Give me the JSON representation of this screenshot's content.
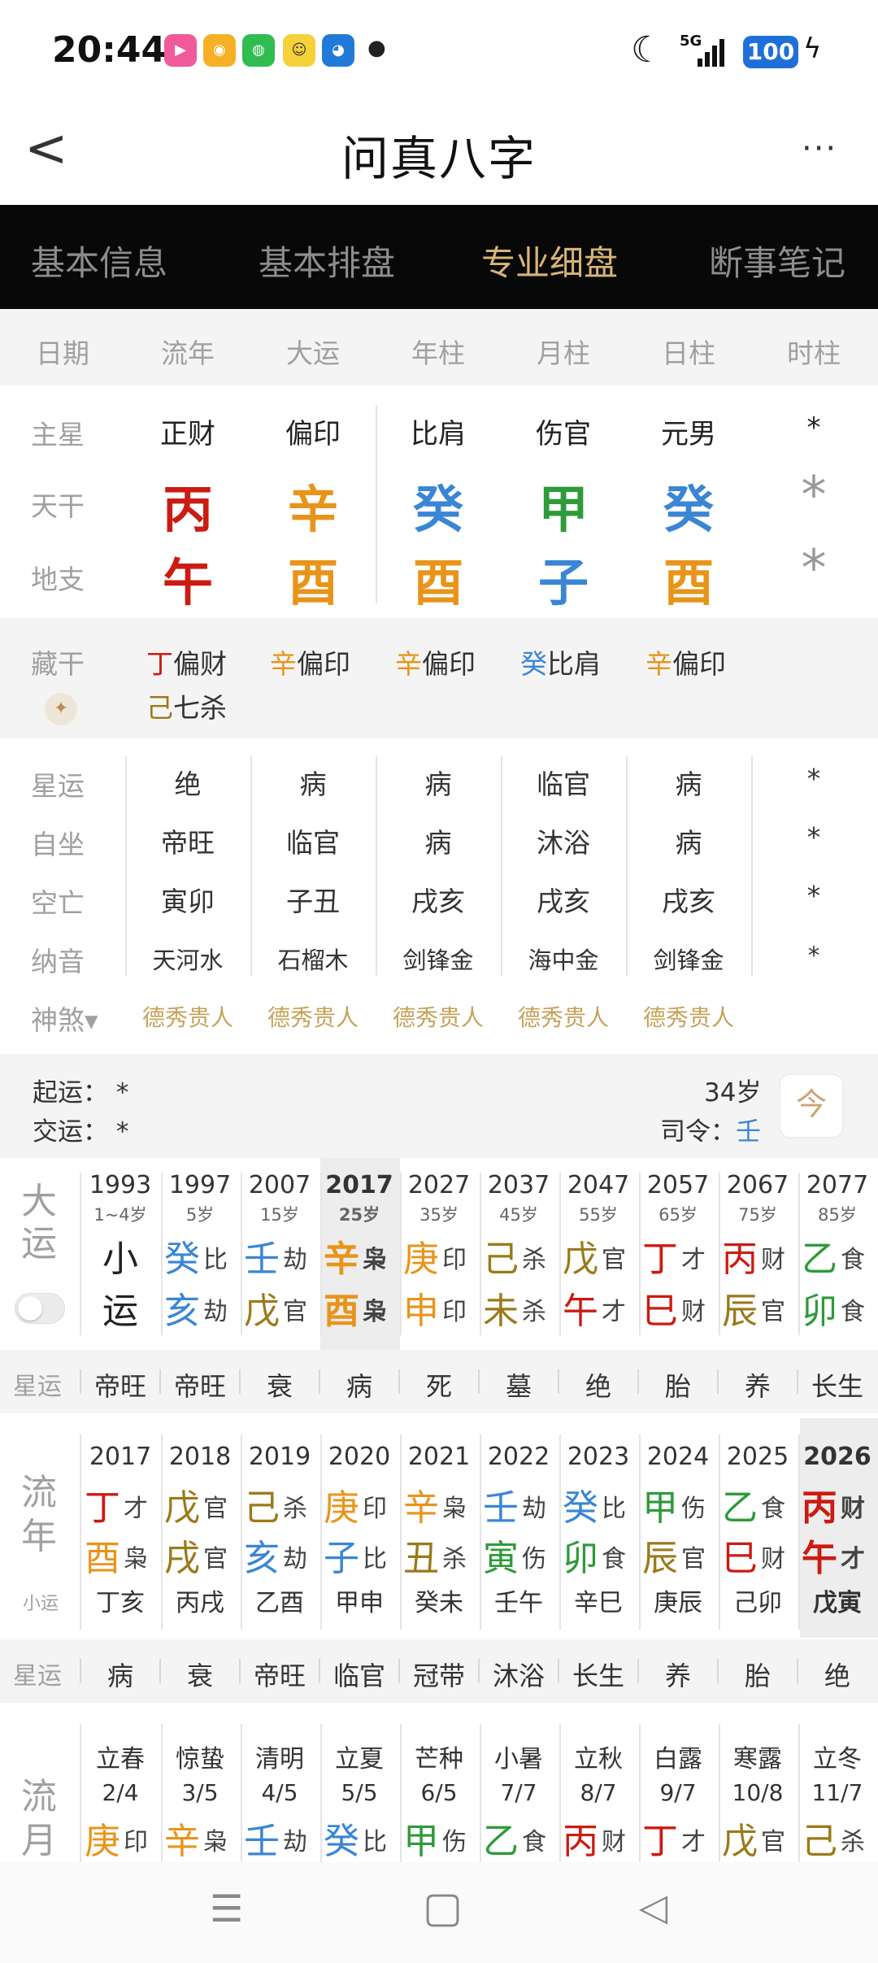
{
  "status": {
    "time": "20:44",
    "battery": "100",
    "signal": "5G",
    "dot": "●"
  },
  "header": {
    "back": "<",
    "title": "问真八字",
    "more": "···"
  },
  "tabs": [
    {
      "label": "基本信息"
    },
    {
      "label": "基本排盘"
    },
    {
      "label": "专业细盘"
    },
    {
      "label": "断事笔记"
    }
  ],
  "columns": [
    "日期",
    "流年",
    "大运",
    "年柱",
    "月柱",
    "日柱",
    "时柱"
  ],
  "pan": {
    "zhuxing_label": "主星",
    "zhuxing": [
      "正财",
      "偏印",
      "比肩",
      "伤官",
      "元男",
      "*"
    ],
    "tiangan_label": "天干",
    "tiangan": [
      "丙",
      "辛",
      "癸",
      "甲",
      "癸",
      "*"
    ],
    "dizhi_label": "地支",
    "dizhi": [
      "午",
      "酉",
      "酉",
      "子",
      "酉",
      "*"
    ]
  },
  "canggan": {
    "label": "藏干",
    "c1a_g": "丁",
    "c1a_t": "偏财",
    "c1b_g": "己",
    "c1b_t": "七杀",
    "c2_g": "辛",
    "c2_t": "偏印",
    "c3_g": "辛",
    "c3_t": "偏印",
    "c4_g": "癸",
    "c4_t": "比肩",
    "c5_g": "辛",
    "c5_t": "偏印"
  },
  "detail": {
    "xingyun_label": "星运",
    "xingyun": [
      "绝",
      "病",
      "病",
      "临官",
      "病",
      "*"
    ],
    "zizuo_label": "自坐",
    "zizuo": [
      "帝旺",
      "临官",
      "病",
      "沐浴",
      "病",
      "*"
    ],
    "kongwang_label": "空亡",
    "kongwang": [
      "寅卯",
      "子丑",
      "戌亥",
      "戌亥",
      "戌亥",
      "*"
    ],
    "nayin_label": "纳音",
    "nayin": [
      "天河水",
      "石榴木",
      "剑锋金",
      "海中金",
      "剑锋金",
      "*"
    ],
    "shensha_label": "神煞▾",
    "shensha": [
      "德秀贵人",
      "德秀贵人",
      "德秀贵人",
      "德秀贵人",
      "德秀贵人"
    ]
  },
  "qiyun": {
    "qiyun_label": "起运：",
    "qiyun_val": "*",
    "jiaoyun_label": "交运：",
    "jiaoyun_val": "*",
    "age": "34岁",
    "siling_label": "司令：",
    "siling_val": "壬",
    "cal_icon": "今"
  },
  "dayun": {
    "side1": "大",
    "side2": "运",
    "years": [
      "1993",
      "1997",
      "2007",
      "2017",
      "2027",
      "2037",
      "2047",
      "2057",
      "2067",
      "2077"
    ],
    "ages": [
      "1~4岁",
      "5岁",
      "15岁",
      "25岁",
      "35岁",
      "45岁",
      "55岁",
      "65岁",
      "75岁",
      "85岁"
    ],
    "top": [
      [
        "小",
        ""
      ],
      [
        "癸",
        "比"
      ],
      [
        "壬",
        "劫"
      ],
      [
        "辛",
        "枭"
      ],
      [
        "庚",
        "印"
      ],
      [
        "己",
        "杀"
      ],
      [
        "戊",
        "官"
      ],
      [
        "丁",
        "才"
      ],
      [
        "丙",
        "财"
      ],
      [
        "乙",
        "食"
      ]
    ],
    "bot": [
      [
        "运",
        ""
      ],
      [
        "亥",
        "劫"
      ],
      [
        "戊",
        "官"
      ],
      [
        "酉",
        "枭"
      ],
      [
        "申",
        "印"
      ],
      [
        "未",
        "杀"
      ],
      [
        "午",
        "才"
      ],
      [
        "巳",
        "财"
      ],
      [
        "辰",
        "官"
      ],
      [
        "卯",
        "食"
      ]
    ]
  },
  "dayun_strip": {
    "label": "星运",
    "items": [
      "帝旺",
      "帝旺",
      "衰",
      "病",
      "死",
      "墓",
      "绝",
      "胎",
      "养",
      "长生"
    ]
  },
  "liunian": {
    "side1": "流",
    "side2": "年",
    "side3": "小运",
    "years": [
      "2017",
      "2018",
      "2019",
      "2020",
      "2021",
      "2022",
      "2023",
      "2024",
      "2025",
      "2026"
    ],
    "top": [
      [
        "丁",
        "才"
      ],
      [
        "戊",
        "官"
      ],
      [
        "己",
        "杀"
      ],
      [
        "庚",
        "印"
      ],
      [
        "辛",
        "枭"
      ],
      [
        "壬",
        "劫"
      ],
      [
        "癸",
        "比"
      ],
      [
        "甲",
        "伤"
      ],
      [
        "乙",
        "食"
      ],
      [
        "丙",
        "财"
      ]
    ],
    "bot": [
      [
        "酉",
        "枭"
      ],
      [
        "戌",
        "官"
      ],
      [
        "亥",
        "劫"
      ],
      [
        "子",
        "比"
      ],
      [
        "丑",
        "杀"
      ],
      [
        "寅",
        "伤"
      ],
      [
        "卯",
        "食"
      ],
      [
        "辰",
        "官"
      ],
      [
        "巳",
        "财"
      ],
      [
        "午",
        "才"
      ]
    ],
    "xiaoyun": [
      "丁亥",
      "丙戌",
      "乙酉",
      "甲申",
      "癸未",
      "壬午",
      "辛巳",
      "庚辰",
      "己卯",
      "戊寅"
    ]
  },
  "liunian_strip": {
    "label": "星运",
    "items": [
      "病",
      "衰",
      "帝旺",
      "临官",
      "冠带",
      "沐浴",
      "长生",
      "养",
      "胎",
      "绝"
    ]
  },
  "liuyue": {
    "side1": "流",
    "side2": "月",
    "terms": [
      "立春",
      "惊蛰",
      "清明",
      "立夏",
      "芒种",
      "小暑",
      "立秋",
      "白露",
      "寒露",
      "立冬"
    ],
    "dates": [
      "2/4",
      "3/5",
      "4/5",
      "5/5",
      "6/5",
      "7/7",
      "8/7",
      "9/7",
      "10/8",
      "11/7"
    ],
    "gan": [
      [
        "庚",
        "印"
      ],
      [
        "辛",
        "枭"
      ],
      [
        "壬",
        "劫"
      ],
      [
        "癸",
        "比"
      ],
      [
        "甲",
        "伤"
      ],
      [
        "乙",
        "食"
      ],
      [
        "丙",
        "财"
      ],
      [
        "丁",
        "才"
      ],
      [
        "戊",
        "官"
      ],
      [
        "己",
        "杀"
      ]
    ]
  },
  "navbar": {
    "menu": "☰",
    "home": "▢",
    "back": "◁"
  }
}
